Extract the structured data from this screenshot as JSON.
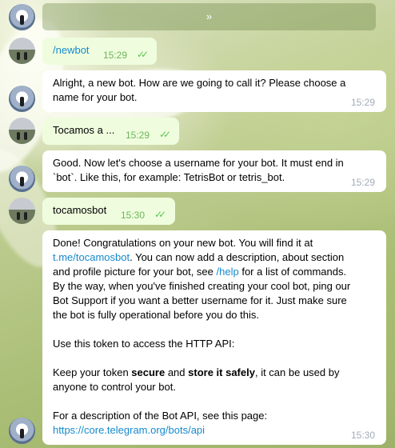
{
  "inline_keyboard": {
    "label": "»"
  },
  "messages": [
    {
      "side": "out",
      "text": "/newbot",
      "time": "15:29"
    },
    {
      "side": "in",
      "lines": [
        "Alright, a new bot. How are we going to call it? Please choose a",
        "name for your bot."
      ],
      "time": "15:29"
    },
    {
      "side": "out",
      "text": "Tocamos a ...",
      "time": "15:29"
    },
    {
      "side": "in",
      "lines": [
        "Good. Now let's choose a username for your bot. It must end in",
        "`bot`. Like this, for example: TetrisBot or tetris_bot."
      ],
      "time": "15:29"
    },
    {
      "side": "out",
      "text": "tocamosbot",
      "time": "15:30"
    }
  ],
  "final": {
    "p1_l1": "Done! Congratulations on your new bot. You will find it at",
    "p1_link": "t.me/tocamosbot",
    "p1_l2_rest": ". You can now add a description, about section",
    "p1_l3_a": "and profile picture for your bot, see ",
    "p1_help": "/help",
    "p1_l3_b": " for a list of commands.",
    "p1_l4": "By the way, when you've finished creating your cool bot, ping our",
    "p1_l5": "Bot Support if you want a better username for it. Just make sure",
    "p1_l6": "the bot is fully operational before you do this.",
    "p2": "Use this token to access the HTTP API:",
    "p3_a": "Keep your token ",
    "p3_b1": "secure",
    "p3_c": " and ",
    "p3_b2": "store it safely",
    "p3_d": ", it can be used by",
    "p3_l2": "anyone to control your bot.",
    "p4": "For a description of the Bot API, see this page:",
    "p4_link": "https://core.telegram.org/bots/api",
    "time": "15:30"
  },
  "colors": {
    "incoming": "#ffffff",
    "outgoing": "#effdde",
    "link": "#168acd",
    "check": "#5dc452"
  }
}
